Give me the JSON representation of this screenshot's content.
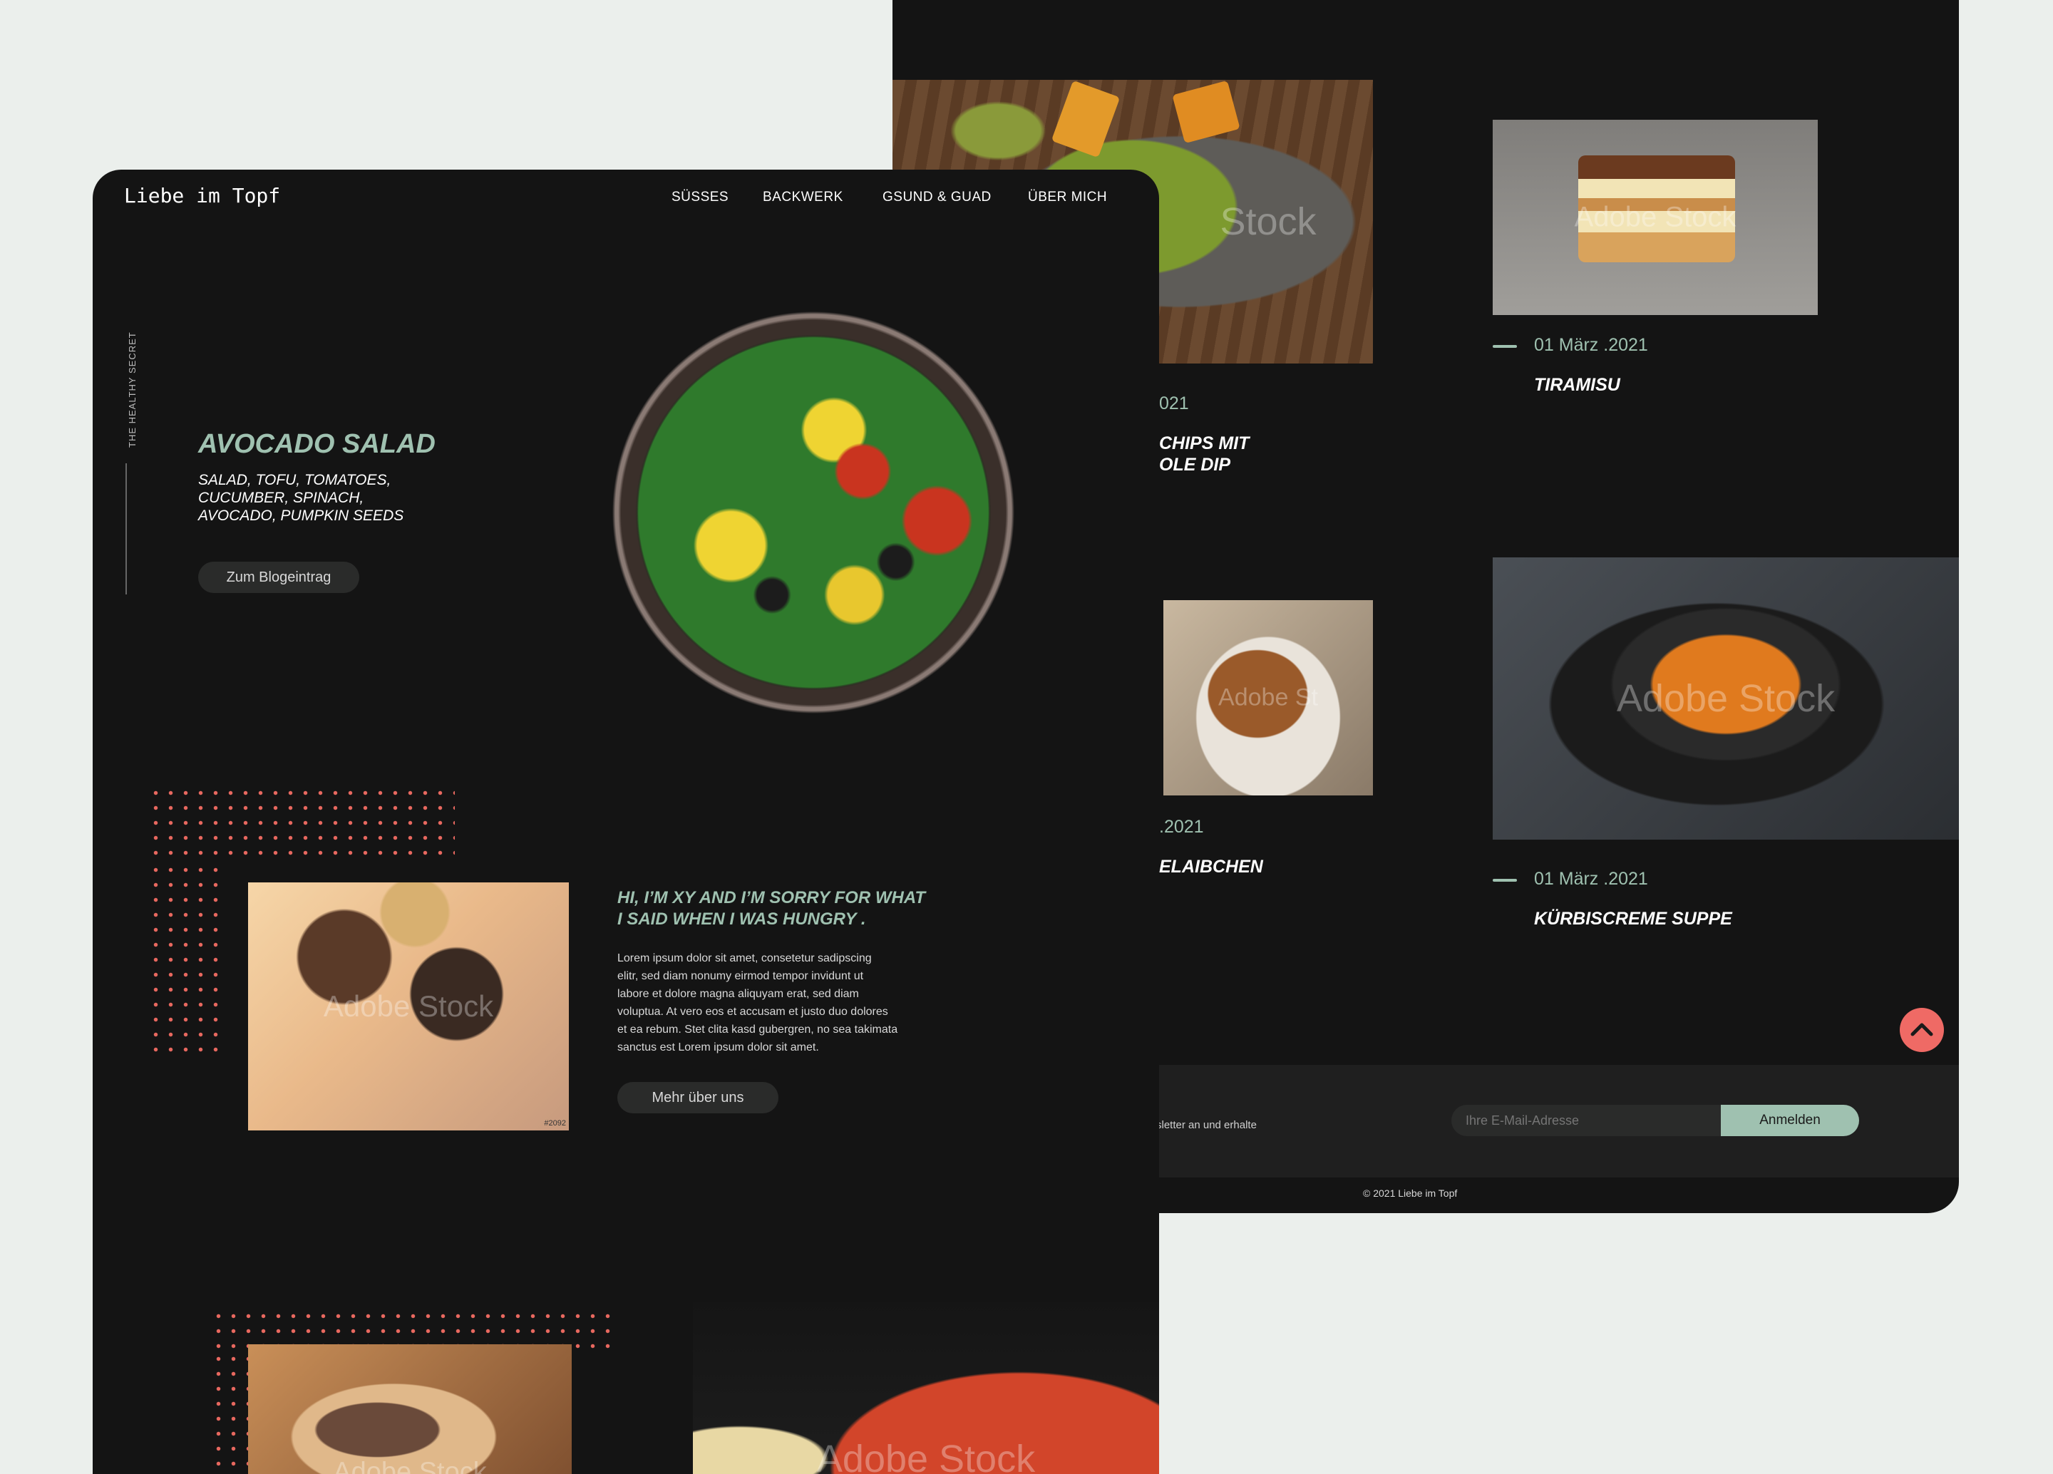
{
  "back_page": {
    "posts": [
      {
        "date": "021",
        "title_line1": "CHIPS MIT",
        "title_line2": "OLE DIP"
      },
      {
        "date": "01 März .2021",
        "title": "TIRAMISU"
      },
      {
        "date": ".2021",
        "title": "ELAIBCHEN"
      },
      {
        "date": "01 März .2021",
        "title": "KÜRBISCREME SUPPE"
      }
    ],
    "image_watermarks": [
      "Stock",
      "Adobe Stock",
      "Adobe St",
      "Adobe Stock"
    ],
    "newsletter": {
      "text": "sletter an und erhalte",
      "email_placeholder": "Ihre E-Mail-Adresse",
      "submit_label": "Anmelden"
    },
    "copyright": "© 2021 Liebe im Topf"
  },
  "front_page": {
    "logo": "Liebe im Topf",
    "nav": [
      "SÜSSES",
      "BACKWERK",
      "GSUND & GUAD",
      "ÜBER MICH"
    ],
    "side_label": "THE HEALTHY SECRET",
    "hero": {
      "title": "AVOCADO SALAD",
      "ingredients_line1": "SALAD, TOFU, TOMATOES,",
      "ingredients_line2": "CUCUMBER, SPINACH,",
      "ingredients_line3": "AVOCADO, PUMPKIN SEEDS",
      "button": "Zum Blogeintrag"
    },
    "about": {
      "heading_line1": "HI, I’M XY AND I’M SORRY FOR WHAT",
      "heading_line2": "I SAID WHEN I WAS HUNGRY .",
      "body_lines": [
        "Lorem ipsum dolor sit amet, consetetur sadipscing",
        "elitr, sed diam nonumy eirmod tempor invidunt ut",
        "labore et dolore magna aliquyam erat, sed diam",
        "voluptua. At vero eos et accusam et justo duo dolores",
        "et ea rebum. Stet clita kasd gubergren, no sea takimata",
        "sanctus est Lorem ipsum dolor sit amet."
      ],
      "button": "Mehr über uns",
      "photo_watermark": "Adobe Stock",
      "photo_id": "#2092"
    },
    "bottom_watermarks": [
      "Adobe Stock",
      "Adobe Stock"
    ]
  },
  "colors": {
    "page_bg": "#ebefec",
    "screen_bg": "#141414",
    "accent_mint": "#9fc1b0",
    "dots_coral": "#e8685f",
    "scroll_button": "#ef6a65"
  },
  "icons": [
    "chevron-up-icon"
  ]
}
